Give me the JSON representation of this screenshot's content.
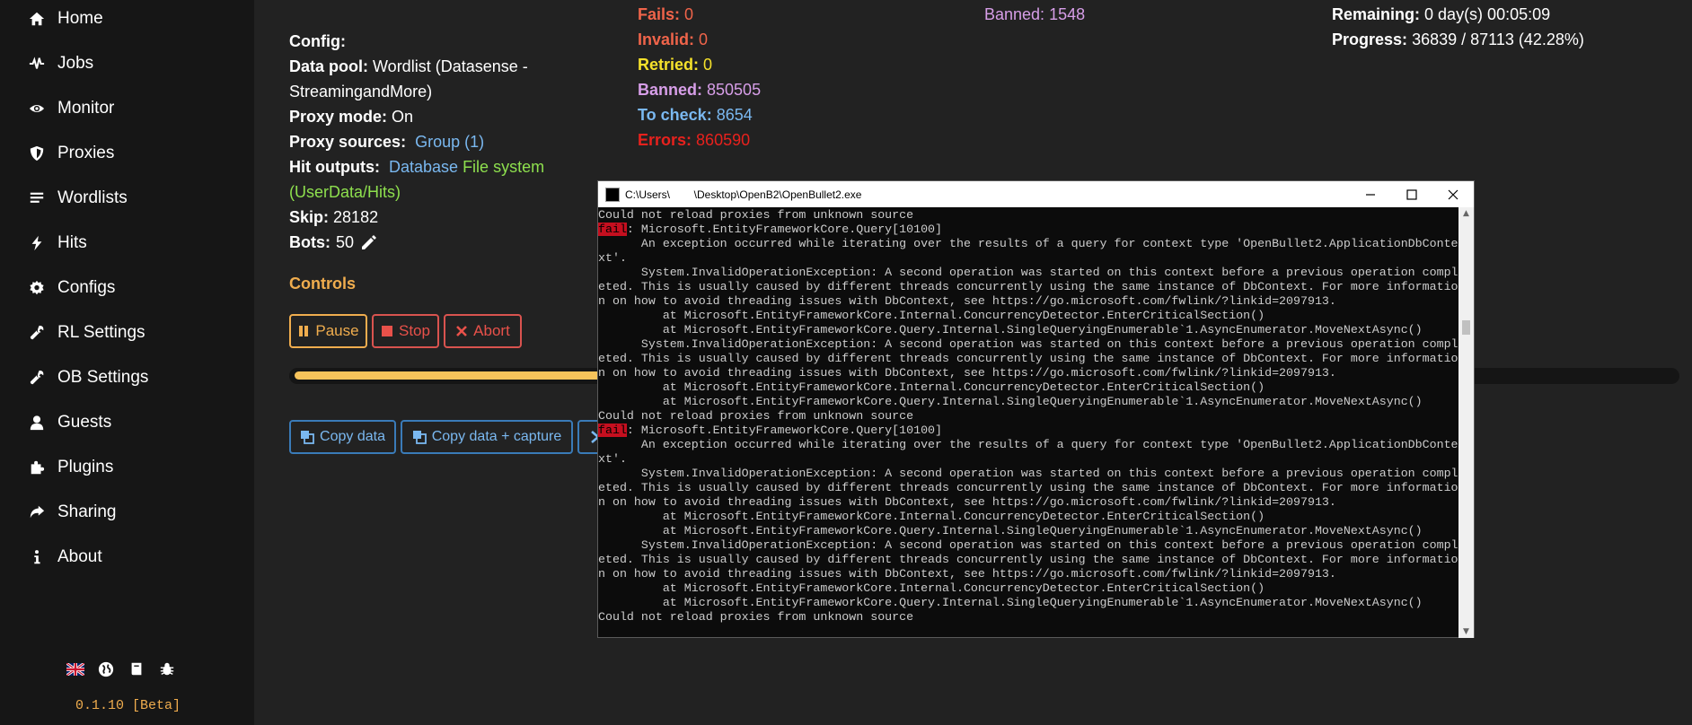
{
  "sidebar": {
    "items": [
      {
        "label": "Home",
        "icon": "home-icon"
      },
      {
        "label": "Jobs",
        "icon": "pulse-icon"
      },
      {
        "label": "Monitor",
        "icon": "eye-icon"
      },
      {
        "label": "Proxies",
        "icon": "shield-icon"
      },
      {
        "label": "Wordlists",
        "icon": "list-icon"
      },
      {
        "label": "Hits",
        "icon": "bolt-icon"
      },
      {
        "label": "Configs",
        "icon": "gear-icon"
      },
      {
        "label": "RL Settings",
        "icon": "wrench-icon"
      },
      {
        "label": "OB Settings",
        "icon": "wrench-icon"
      },
      {
        "label": "Guests",
        "icon": "user-icon"
      },
      {
        "label": "Plugins",
        "icon": "puzzle-icon"
      },
      {
        "label": "Sharing",
        "icon": "share-icon"
      },
      {
        "label": "About",
        "icon": "info-icon"
      }
    ],
    "footer_icons": [
      "uk-flag-icon",
      "globe-icon",
      "book-icon",
      "bug-icon"
    ],
    "version": "0.1.10 [Beta]"
  },
  "job": {
    "config_label": "Config:",
    "data_pool_label": "Data pool:",
    "data_pool_value_1": "Wordlist (Datasense -",
    "data_pool_value_2": "StreamingandMore)",
    "proxy_mode_label": "Proxy mode:",
    "proxy_mode_value": "On",
    "proxy_sources_label": "Proxy sources:",
    "proxy_sources_value": "Group (1)",
    "hit_outputs_label": "Hit outputs:",
    "hit_output_database": "Database",
    "hit_output_file_1": "File system",
    "hit_output_file_2": "(UserData/Hits)",
    "skip_label": "Skip:",
    "skip_value": "28182",
    "bots_label": "Bots:",
    "bots_value": "50"
  },
  "stats": {
    "fails_label": "Fails:",
    "fails_value": "0",
    "invalid_label": "Invalid:",
    "invalid_value": "0",
    "retried_label": "Retried:",
    "retried_value": "0",
    "banned_label": "Banned:",
    "banned_value": "850505",
    "tocheck_label": "To check:",
    "tocheck_value": "8654",
    "errors_label": "Errors:",
    "errors_value": "860590",
    "banned2_label": "Banned:",
    "banned2_value": "1548",
    "remaining_label": "Remaining:",
    "remaining_value": "0 day(s) 00:05:09",
    "progress_label": "Progress:",
    "progress_value": "36839 / 87113 (42.28%)"
  },
  "controls": {
    "title": "Controls",
    "pause": "Pause",
    "stop": "Stop",
    "abort": "Abort",
    "progress_fraction": 0.4228
  },
  "copy": {
    "copy_data": "Copy data",
    "copy_data_capture": "Copy data + capture"
  },
  "colors": {
    "accent": "#f0ad4e",
    "link": "#7ab8f0",
    "green": "#8ee04e",
    "fail": "#f0644a",
    "retried": "#f5e12b",
    "banned": "#d79ee8",
    "tocheck": "#7ab8f0",
    "errors": "#e8211d"
  },
  "console": {
    "title": "C:\\Users\\        \\Desktop\\OpenB2\\OpenBullet2.exe",
    "lines": [
      {
        "text": "Could not reload proxies from unknown source"
      },
      {
        "tag": "fail",
        "text": ": Microsoft.EntityFrameworkCore.Query[10100]"
      },
      {
        "text": "      An exception occurred while iterating over the results of a query for context type 'OpenBullet2.ApplicationDbConte"
      },
      {
        "text": "xt'."
      },
      {
        "text": "      System.InvalidOperationException: A second operation was started on this context before a previous operation compl"
      },
      {
        "text": "eted. This is usually caused by different threads concurrently using the same instance of DbContext. For more informatio"
      },
      {
        "text": "n on how to avoid threading issues with DbContext, see https://go.microsoft.com/fwlink/?linkid=2097913."
      },
      {
        "text": "         at Microsoft.EntityFrameworkCore.Internal.ConcurrencyDetector.EnterCriticalSection()"
      },
      {
        "text": "         at Microsoft.EntityFrameworkCore.Query.Internal.SingleQueryingEnumerable`1.AsyncEnumerator.MoveNextAsync()"
      },
      {
        "text": "      System.InvalidOperationException: A second operation was started on this context before a previous operation compl"
      },
      {
        "text": "eted. This is usually caused by different threads concurrently using the same instance of DbContext. For more informatio"
      },
      {
        "text": "n on how to avoid threading issues with DbContext, see https://go.microsoft.com/fwlink/?linkid=2097913."
      },
      {
        "text": "         at Microsoft.EntityFrameworkCore.Internal.ConcurrencyDetector.EnterCriticalSection()"
      },
      {
        "text": "         at Microsoft.EntityFrameworkCore.Query.Internal.SingleQueryingEnumerable`1.AsyncEnumerator.MoveNextAsync()"
      },
      {
        "text": "Could not reload proxies from unknown source"
      },
      {
        "tag": "fail",
        "text": ": Microsoft.EntityFrameworkCore.Query[10100]"
      },
      {
        "text": "      An exception occurred while iterating over the results of a query for context type 'OpenBullet2.ApplicationDbConte"
      },
      {
        "text": "xt'."
      },
      {
        "text": "      System.InvalidOperationException: A second operation was started on this context before a previous operation compl"
      },
      {
        "text": "eted. This is usually caused by different threads concurrently using the same instance of DbContext. For more informatio"
      },
      {
        "text": "n on how to avoid threading issues with DbContext, see https://go.microsoft.com/fwlink/?linkid=2097913."
      },
      {
        "text": "         at Microsoft.EntityFrameworkCore.Internal.ConcurrencyDetector.EnterCriticalSection()"
      },
      {
        "text": "         at Microsoft.EntityFrameworkCore.Query.Internal.SingleQueryingEnumerable`1.AsyncEnumerator.MoveNextAsync()"
      },
      {
        "text": "      System.InvalidOperationException: A second operation was started on this context before a previous operation compl"
      },
      {
        "text": "eted. This is usually caused by different threads concurrently using the same instance of DbContext. For more informatio"
      },
      {
        "text": "n on how to avoid threading issues with DbContext, see https://go.microsoft.com/fwlink/?linkid=2097913."
      },
      {
        "text": "         at Microsoft.EntityFrameworkCore.Internal.ConcurrencyDetector.EnterCriticalSection()"
      },
      {
        "text": "         at Microsoft.EntityFrameworkCore.Query.Internal.SingleQueryingEnumerable`1.AsyncEnumerator.MoveNextAsync()"
      },
      {
        "text": "Could not reload proxies from unknown source"
      }
    ],
    "fail_tag": "fail"
  }
}
